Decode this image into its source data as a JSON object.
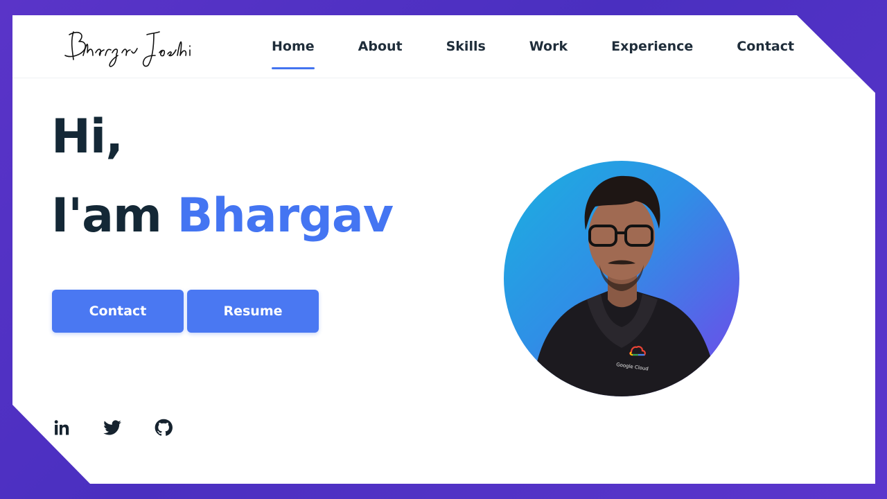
{
  "brand": {
    "logo_text": "Bhargav Joshi"
  },
  "nav": {
    "items": [
      {
        "label": "Home",
        "active": true
      },
      {
        "label": "About",
        "active": false
      },
      {
        "label": "Skills",
        "active": false
      },
      {
        "label": "Work",
        "active": false
      },
      {
        "label": "Experience",
        "active": false
      },
      {
        "label": "Contact",
        "active": false
      }
    ]
  },
  "hero": {
    "greeting": "Hi,",
    "intro": "I'am ",
    "name": "Bhargav"
  },
  "buttons": {
    "contact_label": "Contact",
    "resume_label": "Resume"
  },
  "social": {
    "icons": [
      "linkedin-icon",
      "twitter-icon",
      "github-icon"
    ]
  },
  "profile": {
    "shirt_text": "Google Cloud"
  },
  "colors": {
    "accent": "#4475f2",
    "heading": "#142836",
    "background": "#5a34c8",
    "card": "#ffffff"
  }
}
